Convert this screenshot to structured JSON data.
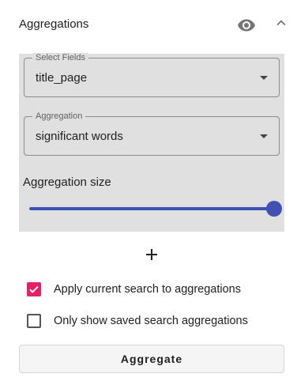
{
  "header": {
    "title": "Aggregations",
    "visibility_icon": "eye-icon",
    "collapse_icon": "chevron-up-icon"
  },
  "fields": [
    {
      "label": "Select Fields",
      "value": "title_page"
    },
    {
      "label": "Aggregation",
      "value": "significant words"
    }
  ],
  "aggregation_size": {
    "label": "Aggregation size",
    "value_fraction": 1.0
  },
  "add_icon": "plus-icon",
  "checkboxes": [
    {
      "label": "Apply current search to aggregations",
      "checked": true
    },
    {
      "label": "Only show saved search aggregations",
      "checked": false
    }
  ],
  "aggregate_button": {
    "label": "Aggregate"
  },
  "colors": {
    "accent": "#3f51b5",
    "checkbox_checked": "#e91e63",
    "panel_bg": "#e0e0e0"
  }
}
